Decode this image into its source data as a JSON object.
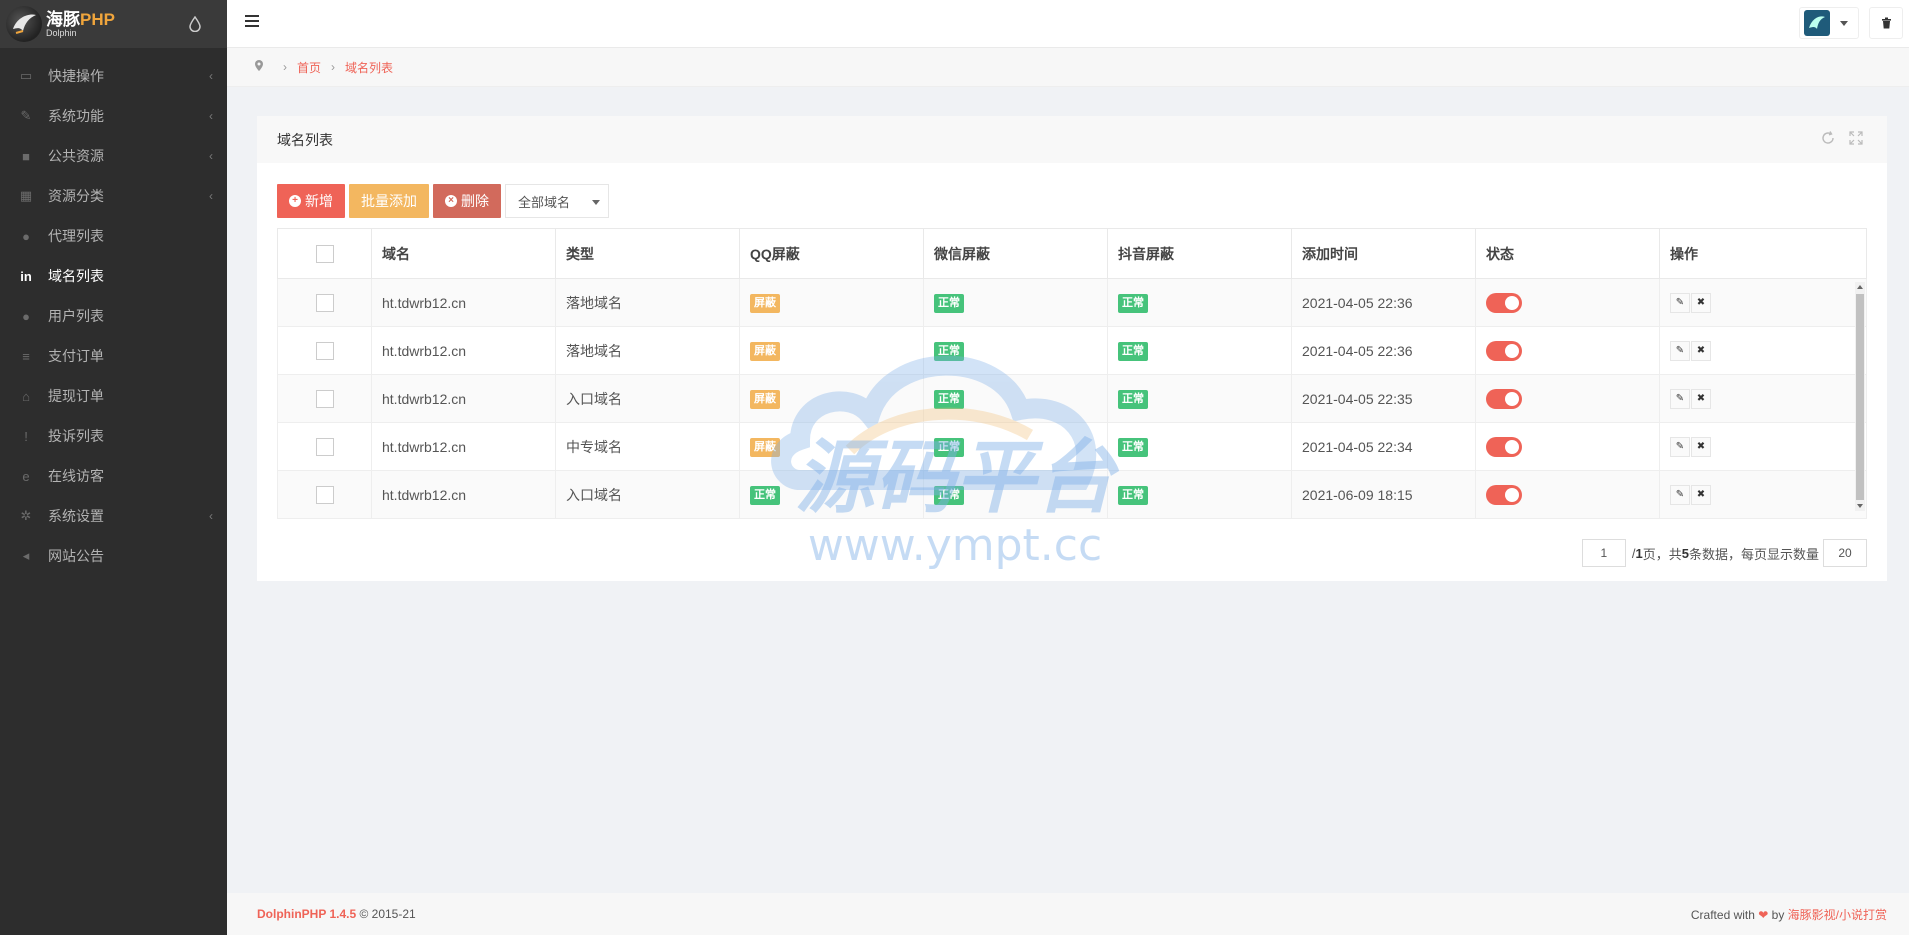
{
  "app": {
    "logo_title": "海豚",
    "logo_title_suffix": "PHP",
    "logo_sub": "Dolphin"
  },
  "sidebar": {
    "items": [
      {
        "label": "快捷操作",
        "icon": "folder-open-icon",
        "has_children": true
      },
      {
        "label": "系统功能",
        "icon": "wrench-icon",
        "has_children": true
      },
      {
        "label": "公共资源",
        "icon": "video-camera-icon",
        "has_children": true
      },
      {
        "label": "资源分类",
        "icon": "grid-icon",
        "has_children": true
      },
      {
        "label": "代理列表",
        "icon": "users-icon",
        "has_children": false
      },
      {
        "label": "域名列表",
        "icon": "linkedin-icon",
        "has_children": false,
        "active": true
      },
      {
        "label": "用户列表",
        "icon": "user-icon",
        "has_children": false
      },
      {
        "label": "支付订单",
        "icon": "database-icon",
        "has_children": false
      },
      {
        "label": "提现订单",
        "icon": "bank-icon",
        "has_children": false
      },
      {
        "label": "投诉列表",
        "icon": "exclamation-circle-icon",
        "has_children": false
      },
      {
        "label": "在线访客",
        "icon": "edge-icon",
        "has_children": false
      },
      {
        "label": "系统设置",
        "icon": "gear-icon",
        "has_children": true
      },
      {
        "label": "网站公告",
        "icon": "bullhorn-icon",
        "has_children": false
      }
    ]
  },
  "breadcrumb": {
    "home": "首页",
    "current": "域名列表"
  },
  "panel": {
    "title": "域名列表"
  },
  "toolbar": {
    "add_label": "新增",
    "batch_add_label": "批量添加",
    "delete_label": "删除",
    "filter_value": "全部域名"
  },
  "table": {
    "columns": [
      "域名",
      "类型",
      "QQ屏蔽",
      "微信屏蔽",
      "抖音屏蔽",
      "添加时间",
      "状态",
      "操作"
    ],
    "rows": [
      {
        "domain": "ht.tdwrb12.cn",
        "type": "落地域名",
        "qq": "屏蔽",
        "qq_state": "warn",
        "wechat": "正常",
        "douyin": "正常",
        "time": "2021-04-05 22:36"
      },
      {
        "domain": "ht.tdwrb12.cn",
        "type": "落地域名",
        "qq": "屏蔽",
        "qq_state": "warn",
        "wechat": "正常",
        "douyin": "正常",
        "time": "2021-04-05 22:36"
      },
      {
        "domain": "ht.tdwrb12.cn",
        "type": "入口域名",
        "qq": "屏蔽",
        "qq_state": "warn",
        "wechat": "正常",
        "douyin": "正常",
        "time": "2021-04-05 22:35"
      },
      {
        "domain": "ht.tdwrb12.cn",
        "type": "中专域名",
        "qq": "屏蔽",
        "qq_state": "warn",
        "wechat": "正常",
        "douyin": "正常",
        "time": "2021-04-05 22:34"
      },
      {
        "domain": "ht.tdwrb12.cn",
        "type": "入口域名",
        "qq": "正常",
        "qq_state": "ok",
        "wechat": "正常",
        "douyin": "正常",
        "time": "2021-06-09 18:15"
      }
    ]
  },
  "pager": {
    "page_value": "1",
    "total_pages_text": "/ ",
    "total_pages": "1",
    "pages_suffix": " 页，共 ",
    "total_count": "5",
    "count_suffix": " 条数据，每页显示数量",
    "page_size": "20"
  },
  "watermark": {
    "title": "源码平台",
    "url": "www.ympt.cc"
  },
  "footer": {
    "brand": "DolphinPHP 1.4.5",
    "copyright": " © 2015-21",
    "crafted": "Crafted with ",
    "by": " by ",
    "author": "海豚影视/小说打赏"
  },
  "colors": {
    "sidebar_bg": "#2d2d2d",
    "accent": "#ef6357",
    "warning": "#f3b760",
    "success": "#46c37b"
  }
}
